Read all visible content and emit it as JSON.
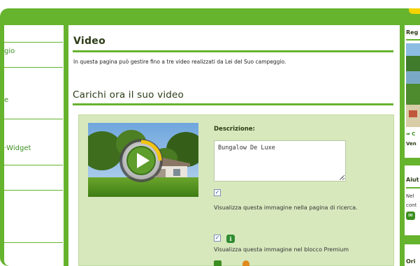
{
  "left_nav": {
    "items": [
      "gio",
      "e",
      "·Widget"
    ]
  },
  "main": {
    "page_title": "Video",
    "intro": "In questa pagina può gestire fino a tre video realizzati da Lei del Suo campeggio.",
    "section_title": "Carichi ora il suo video",
    "video": {
      "description_label": "Descrizione:",
      "description_value": "Bungalow De Luxe",
      "option_search": "Visualizza questa immagine nella pagina di ricerca.",
      "option_premium": "Visualizza questa immagine nel blocco Premium",
      "play_icon": "play-button-icon",
      "info_icon_glyph": "i"
    }
  },
  "right_sidebar": {
    "box1": {
      "title": "Reg",
      "arrow_text": "➡ C",
      "link": "Ven"
    },
    "box2": {
      "title": "Aiut",
      "line1": "Nel",
      "line2": "cont"
    },
    "box3": {
      "title": "Ori"
    }
  },
  "colors": {
    "frame_green": "#66b32e",
    "panel_green": "#d7e8bd",
    "heading_dark": "#2c3c16",
    "accent_yellow": "#f6d300"
  }
}
